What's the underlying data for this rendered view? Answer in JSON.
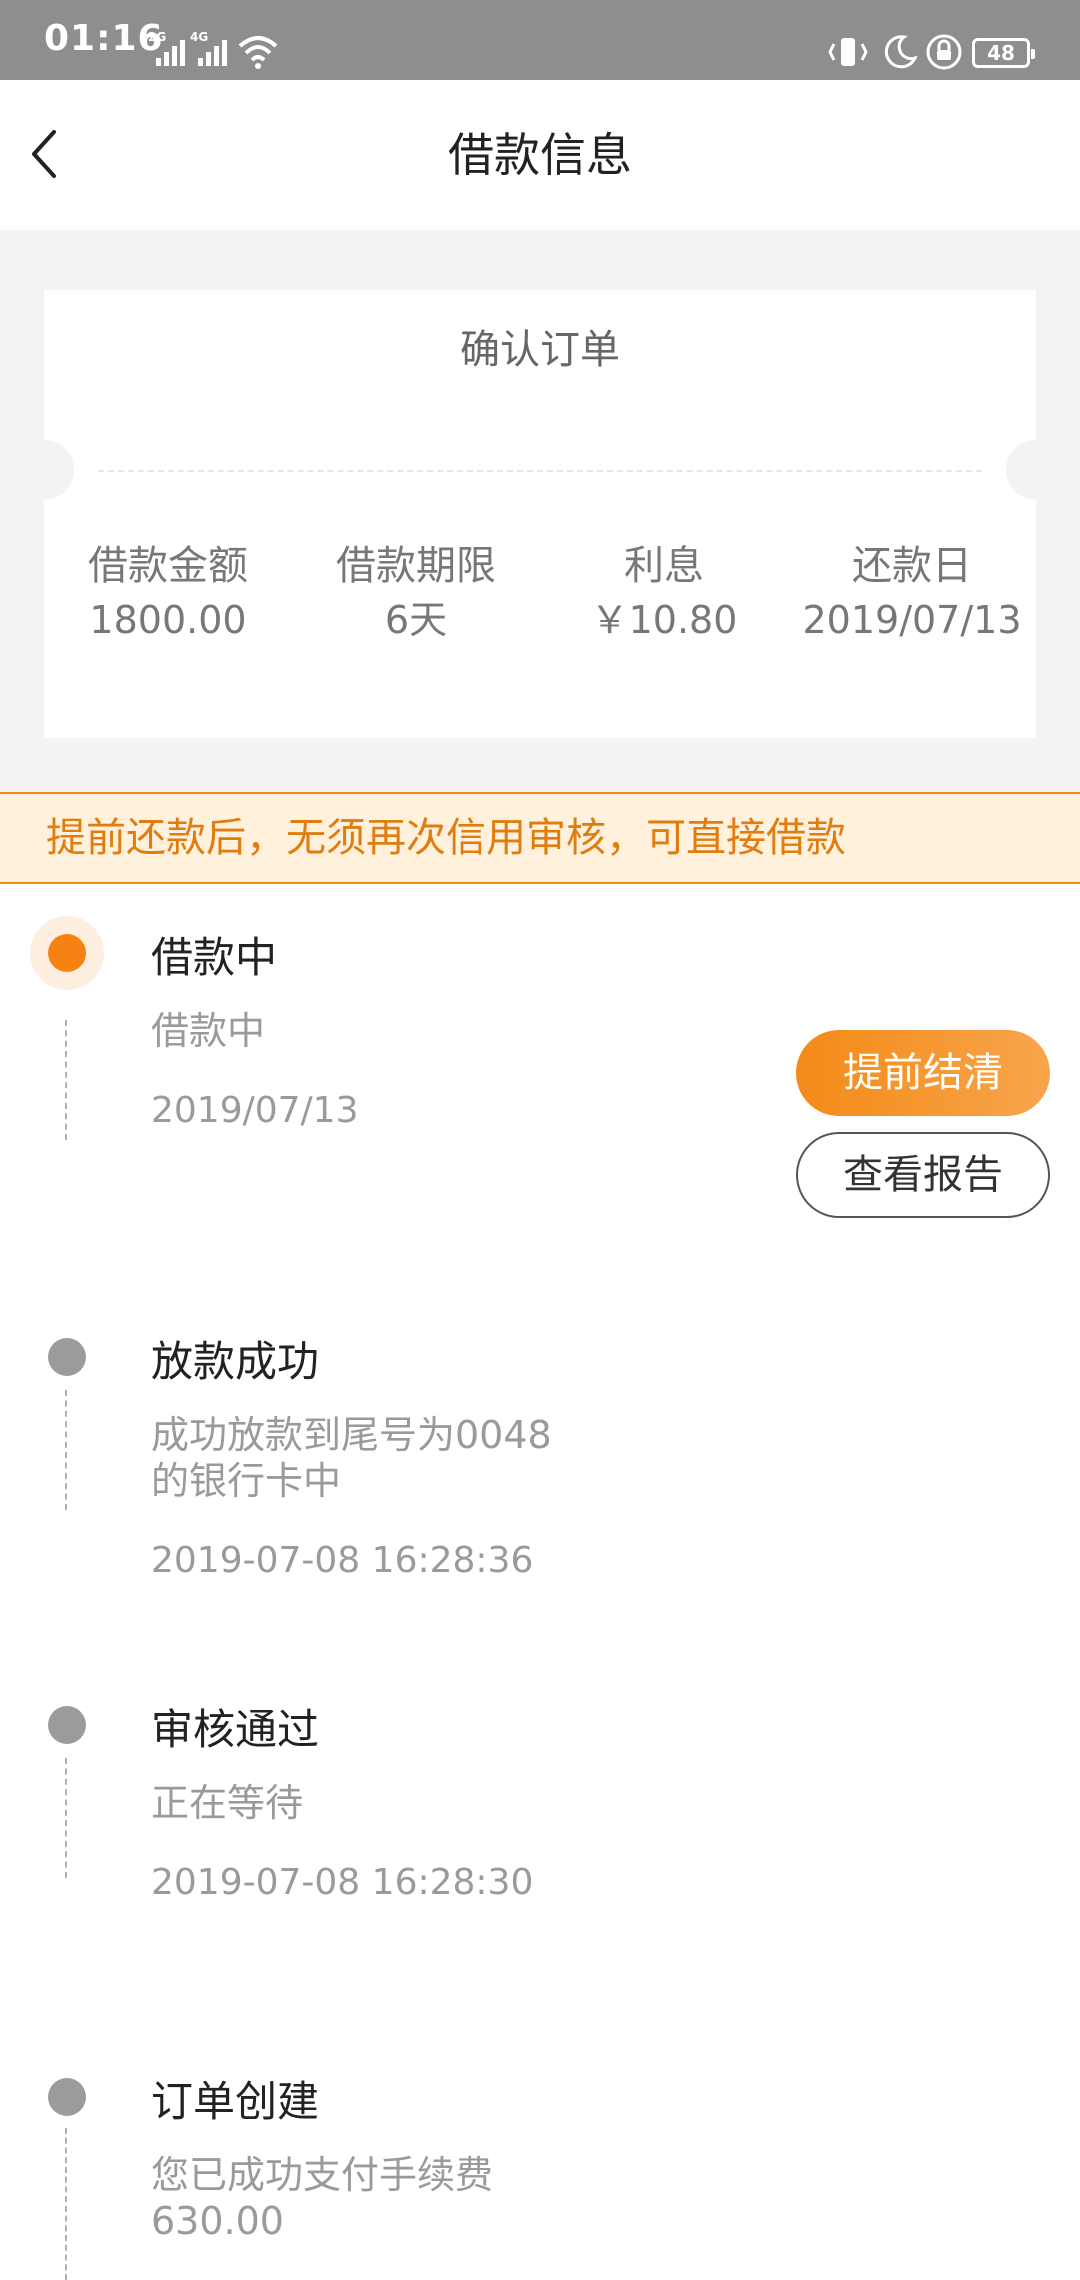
{
  "status_bar": {
    "time": "01:16",
    "signal1_label": "2G",
    "signal2_label": "4G",
    "battery": "48",
    "icons": [
      "wifi-icon",
      "vibrate-icon",
      "moon-icon",
      "lock-rotation-icon"
    ]
  },
  "header": {
    "title": "借款信息",
    "back_icon": "chevron-left-icon"
  },
  "ticket": {
    "title": "确认订单",
    "stats": [
      {
        "label": "借款金额",
        "value": "1800.00"
      },
      {
        "label": "借款期限",
        "value": "6天"
      },
      {
        "label": "利息",
        "value": "￥10.80"
      },
      {
        "label": "还款日",
        "value": "2019/07/13"
      }
    ]
  },
  "notice": {
    "text": "提前还款后，无须再次信用审核，可直接借款"
  },
  "timeline": [
    {
      "title": "借款中",
      "desc_line1": "借款中",
      "desc_line2": "",
      "time": "2019/07/13",
      "active": true
    },
    {
      "title": "放款成功",
      "desc_line1": "成功放款到尾号为0048",
      "desc_line2": "的银行卡中",
      "time": "2019-07-08 16:28:36",
      "active": false
    },
    {
      "title": "审核通过",
      "desc_line1": "正在等待",
      "desc_line2": "",
      "time": "2019-07-08 16:28:30",
      "active": false
    },
    {
      "title": "订单创建",
      "desc_line1": "您已成功支付手续费",
      "desc_line2": "630.00",
      "time": "",
      "active": false
    }
  ],
  "actions": {
    "settle_label": "提前结清",
    "report_label": "查看报告"
  },
  "colors": {
    "accent": "#f58212",
    "notice_bg": "#fff1dc",
    "status_bar": "#8e8e8e",
    "inactive_dot": "#9b9b9b"
  }
}
